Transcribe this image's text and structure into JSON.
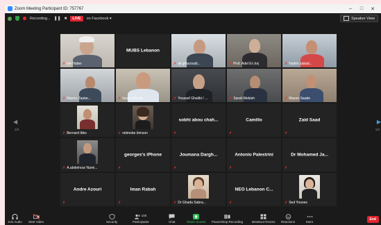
{
  "window": {
    "title": "Zoom Meeting Participant ID: 757767"
  },
  "meeting_bar": {
    "recording_label": "Recording...",
    "live_label": "LIVE",
    "live_target": "on Facebook",
    "speaker_view_label": "Speaker View"
  },
  "colors": {
    "active_speaker": "#b3e042",
    "live": "#e0242e",
    "share": "#2fb85b"
  },
  "participants": [
    {
      "label": "joe Haber"
    },
    {
      "label": "MUBS Lebanon"
    },
    {
      "label": "ali gharzoudi..."
    },
    {
      "label": "Prof. Adel El-Jorj"
    },
    {
      "label": "Nadim zabad..."
    },
    {
      "label": "Mazen Zaatar..."
    },
    {
      "label": "Issam Droubi"
    },
    {
      "label": "Youssef Ghalibi / ..."
    },
    {
      "label": "Sarah Mekieh"
    },
    {
      "label": "Mazen Saade"
    },
    {
      "label": "Bernard Ibbs"
    },
    {
      "label": "nidmobe bimson"
    },
    {
      "label": "sobhi abou chah..."
    },
    {
      "label": "Camillo"
    },
    {
      "label": "Zaid Saad"
    },
    {
      "label": "A.abdelnour Nami..."
    },
    {
      "label": "georges's iPhone"
    },
    {
      "label": "Joumana Dargh..."
    },
    {
      "label": "Antonio Palestrini"
    },
    {
      "label": "Dr Mohamed Ja..."
    },
    {
      "label": "Andre Azouri"
    },
    {
      "label": "Iman Rabah"
    },
    {
      "label": "Dr Ghada Sabra..."
    },
    {
      "label": "NEO Lebanon C..."
    },
    {
      "label": "Sed Younes"
    }
  ],
  "pagination": {
    "left": "1/2",
    "right": "1/2"
  },
  "toolbar": {
    "audio": "Join Audio",
    "video": "Start Video",
    "security": "Security",
    "participants": "Participants",
    "participants_count": "100",
    "chat": "Chat",
    "share": "Share Screen",
    "recording": "Pause/Stop Recording",
    "breakout": "Breakout Rooms",
    "reactions": "Reactions",
    "more": "More",
    "end": "End"
  }
}
